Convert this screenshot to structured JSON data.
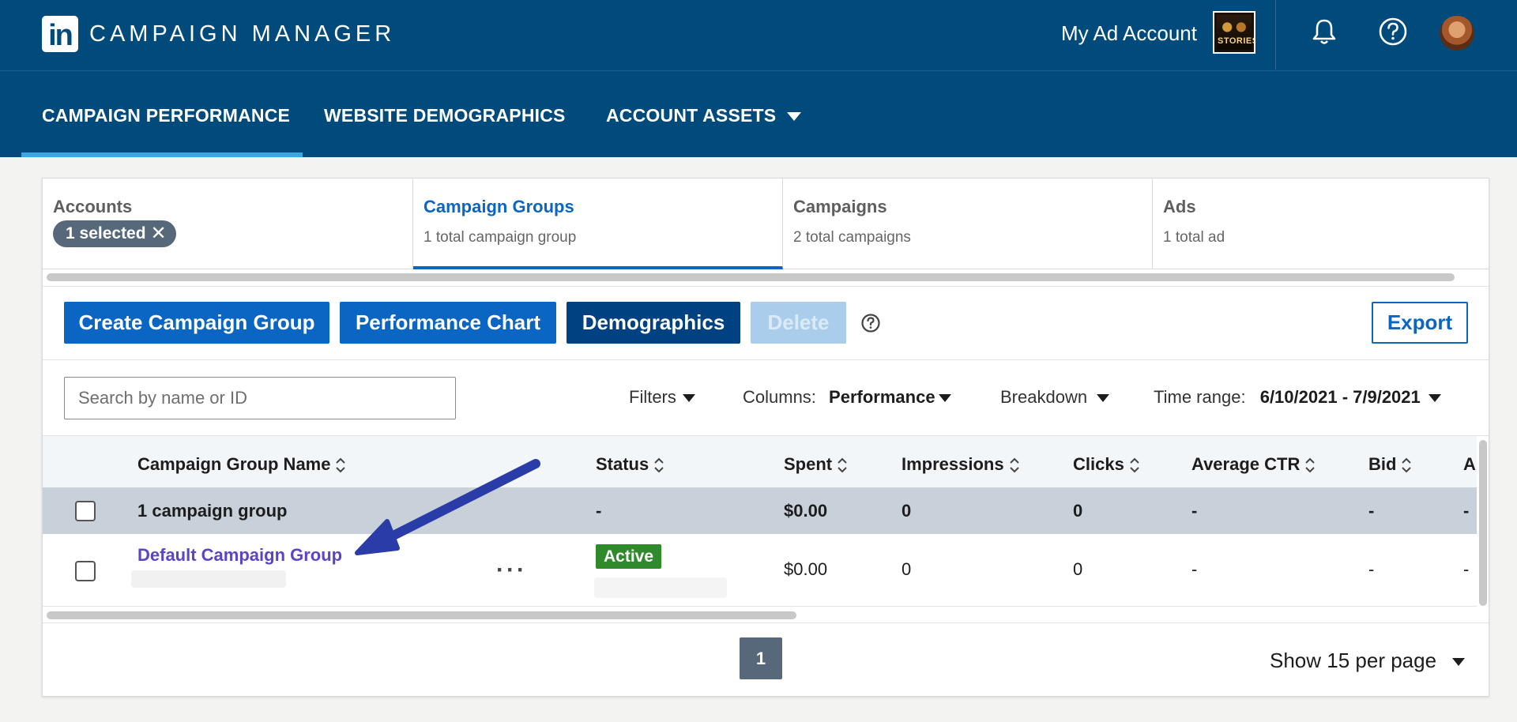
{
  "header": {
    "logo_text": "in",
    "app_title": "CAMPAIGN MANAGER",
    "account_name": "My Ad Account",
    "account_thumb_text": "STORIES",
    "icons": [
      "bell-icon",
      "help-icon",
      "avatar"
    ]
  },
  "nav": {
    "items": [
      {
        "label": "CAMPAIGN PERFORMANCE",
        "active": true
      },
      {
        "label": "WEBSITE DEMOGRAPHICS",
        "active": false
      },
      {
        "label": "ACCOUNT ASSETS",
        "active": false
      }
    ]
  },
  "tabs": [
    {
      "title": "Accounts",
      "pill": "1 selected",
      "pill_close": "✕"
    },
    {
      "title": "Campaign Groups",
      "sub": "1 total campaign group",
      "active": true
    },
    {
      "title": "Campaigns",
      "sub": "2 total campaigns"
    },
    {
      "title": "Ads",
      "sub": "1 total ad"
    }
  ],
  "toolbar": {
    "create": "Create Campaign Group",
    "chart": "Performance Chart",
    "demographics": "Demographics",
    "delete": "Delete",
    "export": "Export"
  },
  "filters": {
    "search_placeholder": "Search by name or ID",
    "filters_label": "Filters",
    "columns_label": "Columns:",
    "columns_value": "Performance",
    "breakdown_label": "Breakdown",
    "time_label": "Time range:",
    "time_value": "6/10/2021 - 7/9/2021"
  },
  "table": {
    "columns": [
      "Campaign Group Name",
      "Status",
      "Spent",
      "Impressions",
      "Clicks",
      "Average CTR",
      "Bid",
      "A"
    ],
    "summary": {
      "name": "1 campaign group",
      "status": "-",
      "spent": "$0.00",
      "impressions": "0",
      "clicks": "0",
      "ctr": "-",
      "bid": "-",
      "extra": "-"
    },
    "rows": [
      {
        "name": "Default Campaign Group",
        "more": "···",
        "status": "Active",
        "spent": "$0.00",
        "impressions": "0",
        "clicks": "0",
        "ctr": "-",
        "bid": "-",
        "extra": "-"
      }
    ]
  },
  "pagination": {
    "page": "1",
    "per_page": "Show 15 per page"
  },
  "colors": {
    "header_bg": "#004b7c",
    "accent": "#0a66c2",
    "active_badge": "#2f8a2b",
    "link": "#5b45c7",
    "arrow": "#2a3ca8"
  }
}
